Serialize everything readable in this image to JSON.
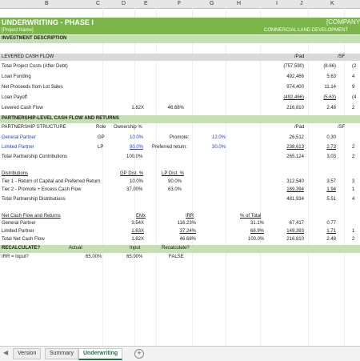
{
  "columns": [
    "B",
    "C",
    "D",
    "E",
    "F",
    "G",
    "H",
    "I",
    "J",
    "K"
  ],
  "title": {
    "left": "UNDERWRITING - PHASE I",
    "right": "[COMPANY"
  },
  "subtitle": {
    "left": "[Project Name]",
    "right": "COMMERCIAL LAND DEVELOPMENT"
  },
  "investment_description": "INVESTMENT DESCRIPTION",
  "cash_flow": {
    "header": "LEVERED CASH FLOW",
    "col_pad": "/Pad",
    "col_sf": "/SF",
    "rows": [
      {
        "label": "Total Project Costs (After Debt)",
        "pad": "(757,590)",
        "sf": "(8.66)",
        "extra": "(2"
      },
      {
        "label": "Loan Funding",
        "pad": "492,466",
        "sf": "5.63",
        "extra": "4"
      },
      {
        "label": "Net Proceeds from Lot Sales",
        "pad": "974,400",
        "sf": "11.14",
        "extra": "9"
      },
      {
        "label": "Loan Payoff",
        "pad": "(492,466)",
        "sf": "(5.63)",
        "extra": "(4"
      }
    ],
    "total": {
      "label": "Levered Cash Flow",
      "multiple": "1.82X",
      "irr": "46.68%",
      "pad": "216,810",
      "sf": "2.48",
      "extra": "2"
    }
  },
  "partnership": {
    "header": "PARTNERSHIP-LEVEL CASH FLOW AND RETURNS",
    "structure_label": "PARTNERSHIP STRUCTURE",
    "role_label": "Role",
    "ownership_label": "Ownership %",
    "col_pad": "/Pad",
    "col_sf": "/SF",
    "gp": {
      "label": "General Partner",
      "role": "GP",
      "own": "10.0%",
      "promote_label": "Promote:",
      "promote": "12.0%",
      "pad": "26,512",
      "sf": "0.30"
    },
    "lp": {
      "label": "Limited Partner",
      "role": "LP",
      "own": "90.0%",
      "pref_label": "Preferred return:",
      "pref": "30.0%",
      "pad": "238,613",
      "sf": "2.73",
      "extra": "2"
    },
    "total": {
      "label": "Total Partnership Contributions",
      "own": "100.0%",
      "pad": "265,124",
      "sf": "3.03",
      "extra": "2"
    }
  },
  "distributions": {
    "header": "Distributions",
    "gp_dist_label": "GP Dist. %",
    "lp_dist_label": "LP Dist. %",
    "rows": [
      {
        "label": "Tier 1 - Return of Capital and Preferred Return",
        "gp": "10.0%",
        "lp": "90.0%",
        "pad": "312,540",
        "sf": "3.57",
        "extra": "3"
      },
      {
        "label": "Tier 2 - Promote + Excess Cash Flow",
        "gp": "37.00%",
        "lp": "63.0%",
        "pad": "169,394",
        "sf": "1.94",
        "extra": "1"
      }
    ],
    "total": {
      "label": "Total Partnership Distributions",
      "pad": "481,934",
      "sf": "5.51",
      "extra": "4"
    }
  },
  "net_cash_flow": {
    "header": "Net Cash Flow and Returns",
    "emx_label": "EMx",
    "irr_label": "IRR",
    "pct_label": "% of Total",
    "rows": [
      {
        "label": "General Partner",
        "emx": "3.54X",
        "irr": "116.23%",
        "pct": "31.1%",
        "pad": "67,417",
        "sf": "0.77"
      },
      {
        "label": "Limited Partner",
        "emx": "1.63X",
        "irr": "37.24%",
        "pct": "68.9%",
        "pad": "149,393",
        "sf": "1.71",
        "extra": "1"
      }
    ],
    "total": {
      "label": "Total Net Cash Flow",
      "emx": "1.82X",
      "irr": "46.68%",
      "pct": "100.0%",
      "pad": "216,810",
      "sf": "2.48",
      "extra": "2"
    }
  },
  "recalc": {
    "header": "RECALCULATE?",
    "actual_label": "Actual",
    "input_label": "Input",
    "recalc_label": "Recalculate?",
    "row_label": "IRR = Input?",
    "actual": "65.00%",
    "input": "65.00%",
    "recalc": "FALSE"
  },
  "sheet_tabs": [
    {
      "label": "Version"
    },
    {
      "label": "Summary"
    },
    {
      "label": "Underwriting",
      "active": true
    }
  ],
  "add_sheet": "+"
}
